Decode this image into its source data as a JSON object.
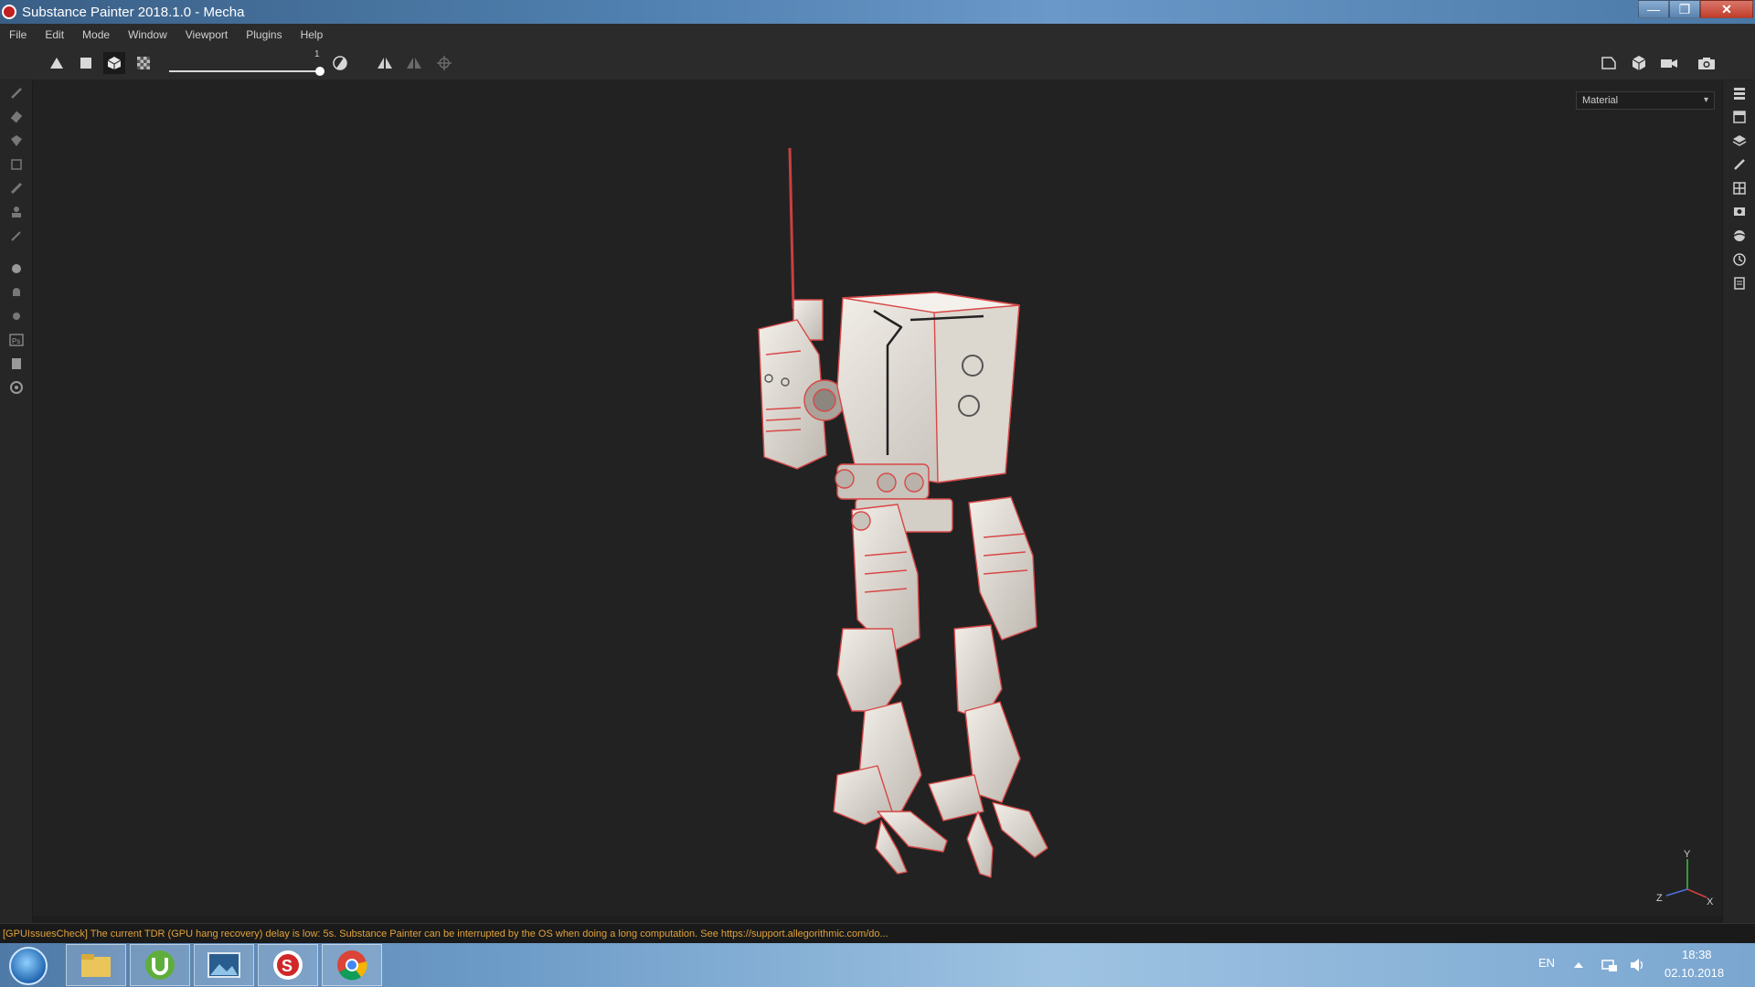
{
  "window": {
    "title": "Substance Painter 2018.1.0 - Mecha",
    "controls": {
      "minimize": "—",
      "maximize": "❐",
      "close": "✕"
    }
  },
  "menu": {
    "items": [
      "File",
      "Edit",
      "Mode",
      "Window",
      "Viewport",
      "Plugins",
      "Help"
    ]
  },
  "toolbar": {
    "slider_value": "1",
    "slider_level": 1.0
  },
  "viewport": {
    "display_mode": "Material",
    "axis_labels": {
      "y": "Y",
      "z": "Z",
      "x": "X"
    }
  },
  "status": {
    "message": "[GPUIssuesCheck] The current TDR (GPU hang recovery) delay is low: 5s. Substance Painter can be interrupted by the OS when doing a long computation. See https://support.allegorithmic.com/do..."
  },
  "taskbar": {
    "language": "EN",
    "time": "18:38",
    "date": "02.10.2018"
  },
  "colors": {
    "wireframe": "#d84848",
    "model_base": "#e8e4de",
    "accent": "#e0a23a"
  }
}
